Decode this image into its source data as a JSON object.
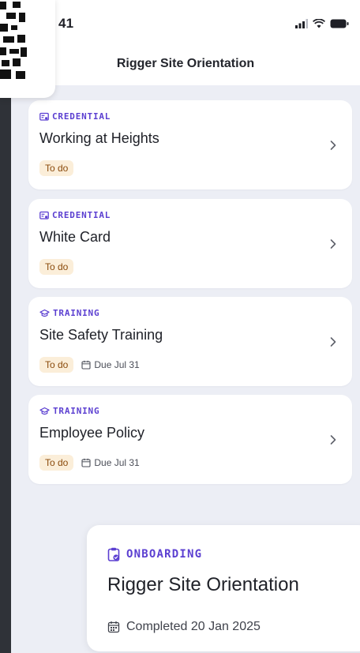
{
  "status_bar": {
    "time": "41"
  },
  "header": {
    "title": "Rigger Site Orientation"
  },
  "items": [
    {
      "kind": "CREDENTIAL",
      "title": "Working at Heights",
      "status": "To do",
      "due": ""
    },
    {
      "kind": "CREDENTIAL",
      "title": "White Card",
      "status": "To do",
      "due": ""
    },
    {
      "kind": "TRAINING",
      "title": "Site Safety Training",
      "status": "To do",
      "due": "Due Jul 31"
    },
    {
      "kind": "TRAINING",
      "title": "Employee Policy",
      "status": "To do",
      "due": "Due Jul 31"
    }
  ],
  "onboarding": {
    "kind": "ONBOARDING",
    "title": "Rigger Site Orientation",
    "completed": "Completed 20 Jan 2025"
  },
  "colors": {
    "accent": "#5b3fd1",
    "badge_bg": "#fbeed9",
    "badge_text": "#8a4a0b"
  }
}
